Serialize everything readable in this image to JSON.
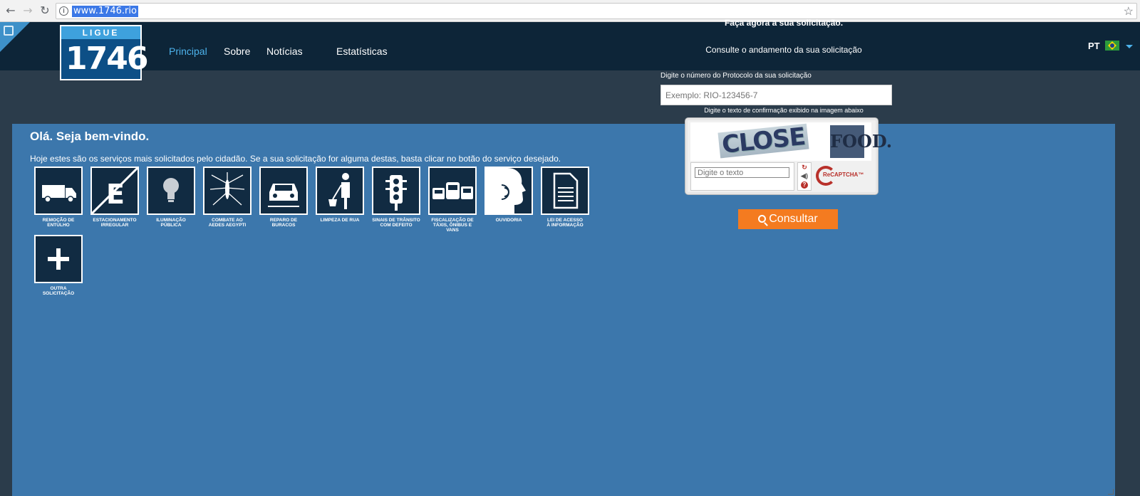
{
  "browser": {
    "url": "www.1746.rio",
    "back_icon": "←",
    "forward_icon": "→",
    "reload_icon": "↻",
    "star_icon": "☆",
    "info_icon": "i"
  },
  "header": {
    "logo_top": "LIGUE",
    "logo_number": "1746",
    "nav": {
      "principal": "Principal",
      "sobre": "Sobre",
      "noticias": "Notícias",
      "estatisticas": "Estatísticas"
    },
    "lang": "PT",
    "accent_color": "#4db3ec",
    "bg_color": "#0d2538"
  },
  "main": {
    "welcome": "Olá. Seja bem-vindo.",
    "subtitle": "Hoje estes são os serviços mais solicitados pelo cidadão. Se a sua solicitação for alguma destas, basta clicar no botão do serviço desejado.",
    "services": [
      {
        "label": "REMOÇÃO DE\nENTULHO",
        "icon": "truck-icon"
      },
      {
        "label": "ESTACIONAMENTO\nIRREGULAR",
        "icon": "no-parking-icon"
      },
      {
        "label": "ILUMINAÇÃO\nPÚBLICA",
        "icon": "lightbulb-icon"
      },
      {
        "label": "COMBATE AO\nAEDES AEGYPTI",
        "icon": "mosquito-icon"
      },
      {
        "label": "REPARO DE\nBURACOS",
        "icon": "car-pothole-icon"
      },
      {
        "label": "LIMPEZA DE RUA",
        "icon": "street-cleaner-icon"
      },
      {
        "label": "SINAIS DE TRÂNSITO\nCOM DEFEITO",
        "icon": "traffic-light-icon"
      },
      {
        "label": "FISCALIZAÇÃO DE\nTÁXIS, ÔNIBUS E VANS",
        "icon": "vehicles-icon"
      },
      {
        "label": "OUVIDORIA",
        "icon": "speaking-head-icon"
      },
      {
        "label": "LEI DE ACESSO\nÀ INFORMAÇÃO",
        "icon": "document-icon"
      },
      {
        "label": "OUTRA\nSOLICITAÇÃO",
        "icon": "plus-icon"
      }
    ],
    "panel_color": "#3c77ac"
  },
  "form": {
    "title": "Faça agora a sua solicitação.",
    "subtitle": "Consulte o andamento da sua solicitação",
    "protocol_label": "Digite o número do Protocolo da sua solicitação",
    "protocol_placeholder": "Exemplo: RIO-123456-7",
    "captcha_label": "Digite o texto de confirmação exibido na imagem abaixo",
    "captcha_word1": "CLOSE",
    "captcha_word2": "FOOD.",
    "captcha_placeholder": "Digite o texto",
    "captcha_refresh": "↻",
    "captcha_audio": "◀)",
    "captcha_help": "?",
    "recaptcha_brand": "ReCAPTCHA™",
    "submit_label": "Consultar",
    "submit_color": "#f47b20"
  }
}
